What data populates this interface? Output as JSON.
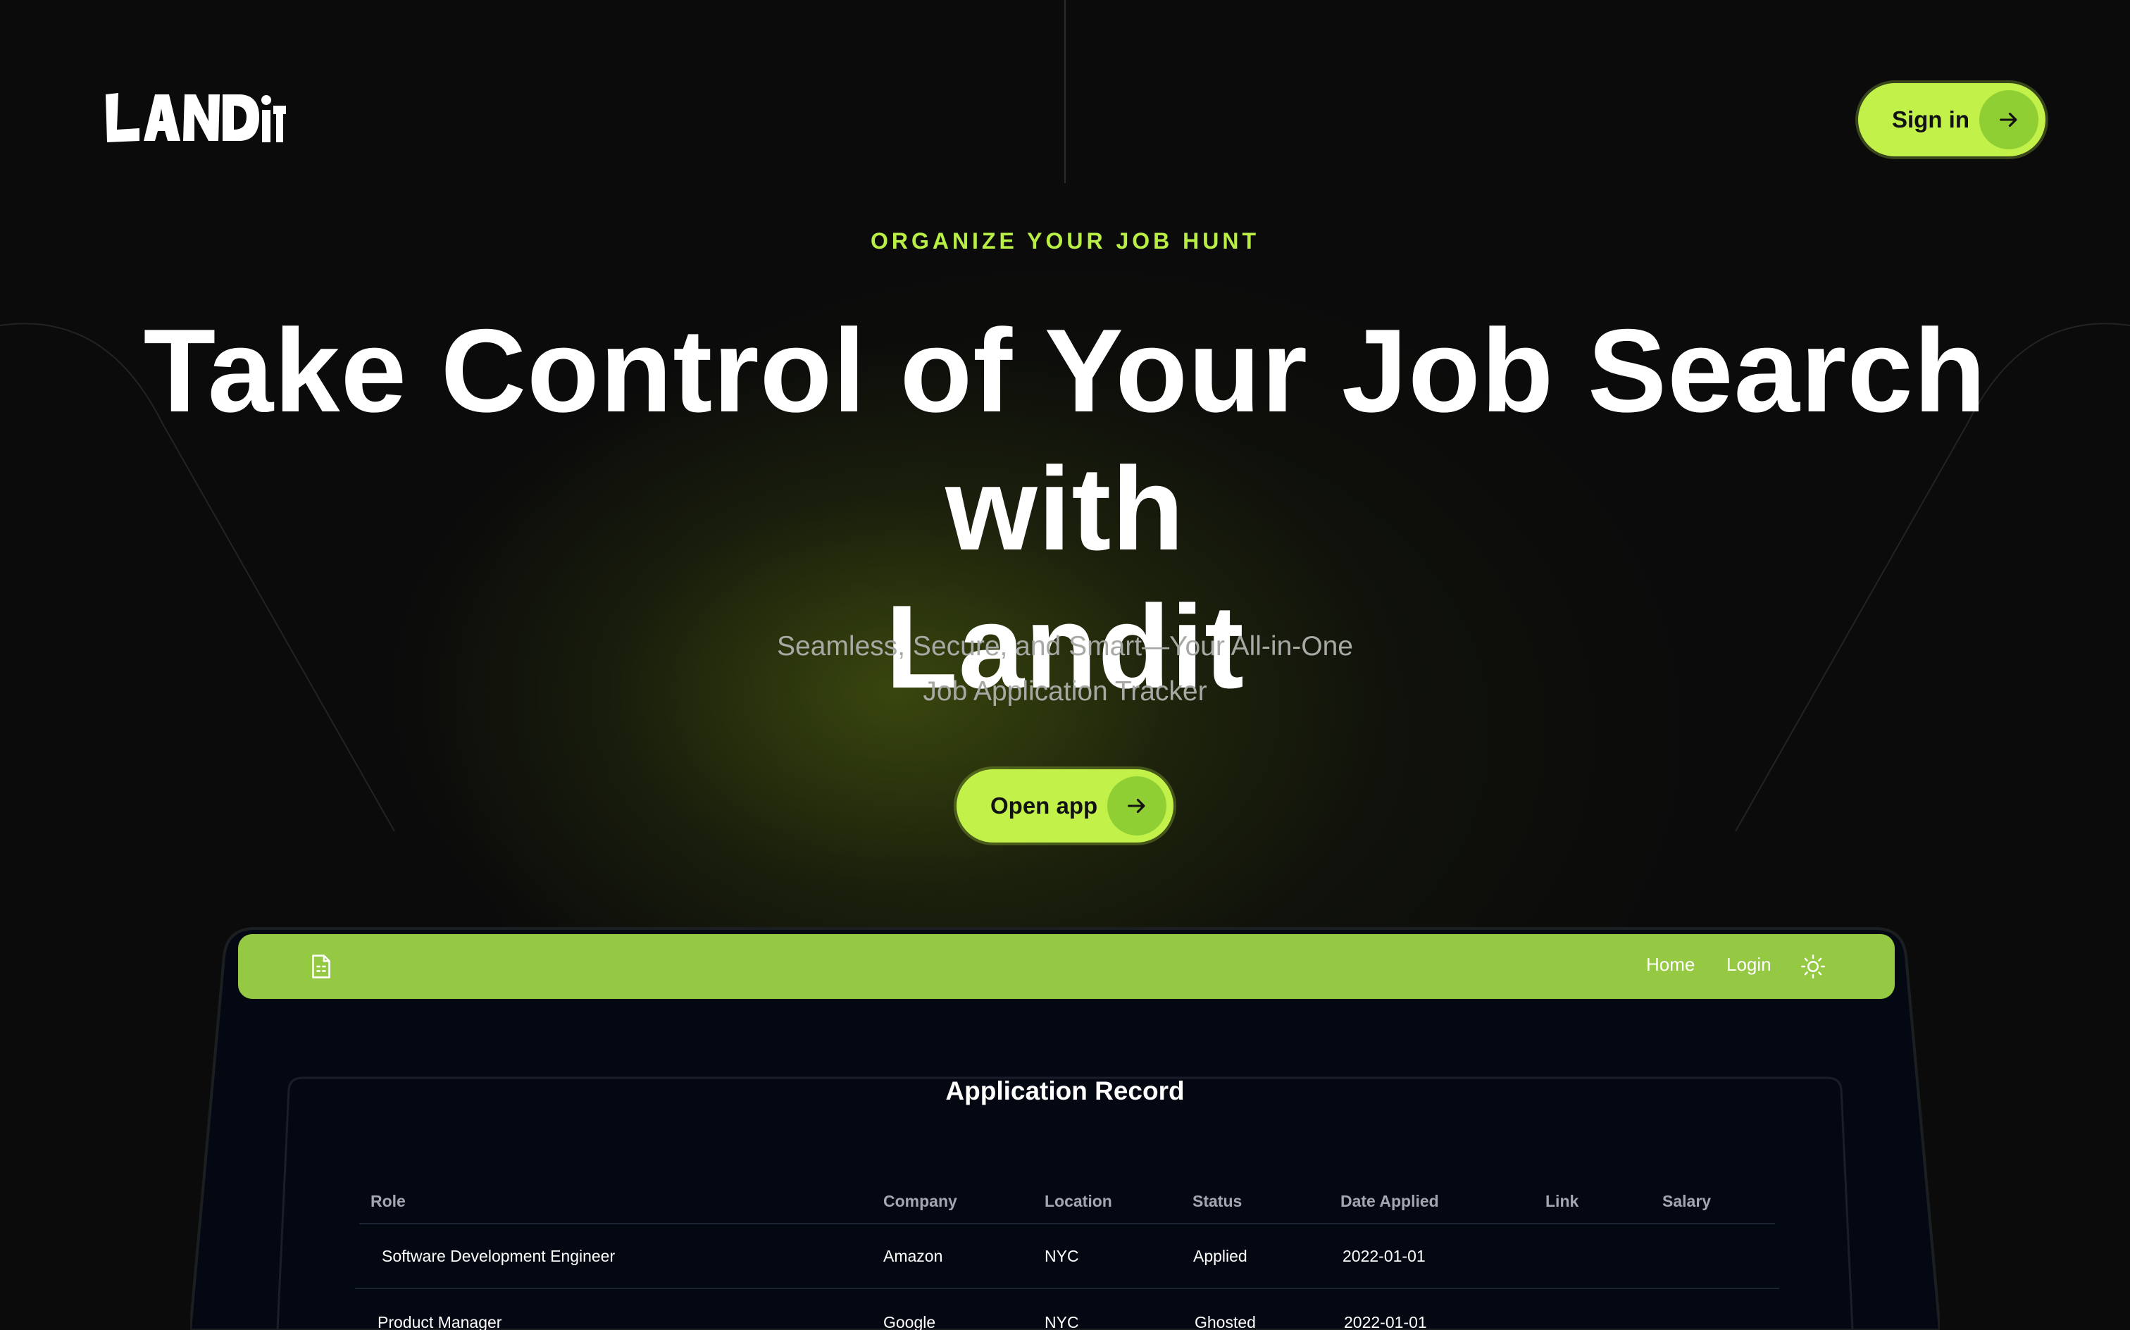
{
  "brand": {
    "logo_text": "LAND iT",
    "accent": "#c2f24a"
  },
  "header": {
    "signin_label": "Sign in"
  },
  "hero": {
    "eyebrow": "ORGANIZE YOUR JOB HUNT",
    "headline_line1": "Take Control of Your Job Search with",
    "headline_line2": "Landit",
    "subline_line1": "Seamless, Secure, and Smart—Your All-in-One",
    "subline_line2": "Job Application Tracker",
    "cta_label": "Open app"
  },
  "app": {
    "nav": {
      "home": "Home",
      "login": "Login",
      "icons": [
        "document-icon",
        "sun-icon"
      ]
    },
    "title": "Application Record",
    "table": {
      "columns": [
        "Role",
        "Company",
        "Location",
        "Status",
        "Date Applied",
        "Link",
        "Salary"
      ],
      "rows": [
        [
          "Software Development Engineer",
          "Amazon",
          "NYC",
          "Applied",
          "2022-01-01",
          "",
          ""
        ],
        [
          "Product Manager",
          "Google",
          "NYC",
          "Ghosted",
          "2022-01-01",
          "",
          ""
        ]
      ]
    }
  }
}
